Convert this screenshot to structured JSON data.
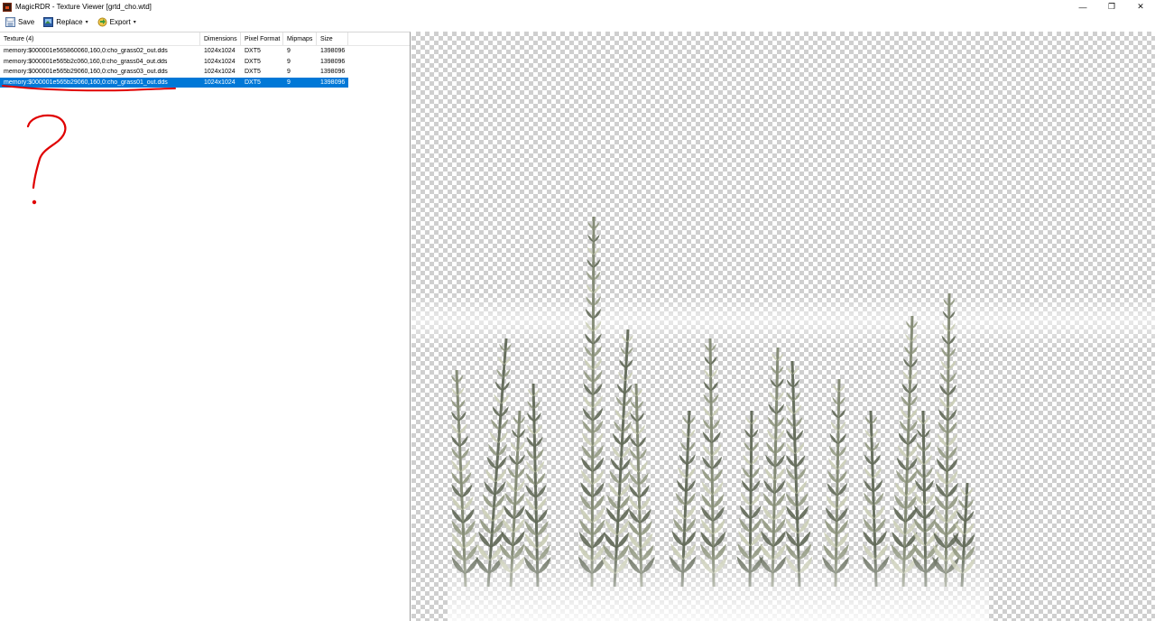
{
  "window": {
    "title": "MagicRDR - Texture Viewer [grtd_cho.wtd]",
    "controls": {
      "minimize": "—",
      "maximize": "❐",
      "close": "✕"
    }
  },
  "toolbar": {
    "save_label": "Save",
    "replace_label": "Replace",
    "export_label": "Export",
    "dropdown_arrow": "▾"
  },
  "texture_list": {
    "columns": [
      "Texture (4)",
      "Dimensions",
      "Pixel Format",
      "Mipmaps",
      "Size"
    ],
    "rows": [
      [
        "memory:$000001e565860060,160,0:cho_grass02_out.dds",
        "1024x1024",
        "DXT5",
        "9",
        "1398096"
      ],
      [
        "memory:$000001e565b2c060,160,0:cho_grass04_out.dds",
        "1024x1024",
        "DXT5",
        "9",
        "1398096"
      ],
      [
        "memory:$000001e565b29060,160,0:cho_grass03_out.dds",
        "1024x1024",
        "DXT5",
        "9",
        "1398096"
      ],
      [
        "memory:$000001e565b29060,160,0:cho_grass01_out.dds",
        "1024x1024",
        "DXT5",
        "9",
        "1398096"
      ]
    ],
    "selected_index": 3
  },
  "colors": {
    "selection": "#0078d7",
    "annotation": "#e00000",
    "grass_dark": "#5a6350",
    "grass_light": "#c9ccb4"
  },
  "icons": {
    "save": "save-disk-icon",
    "replace": "replace-image-icon",
    "export": "export-icon"
  }
}
